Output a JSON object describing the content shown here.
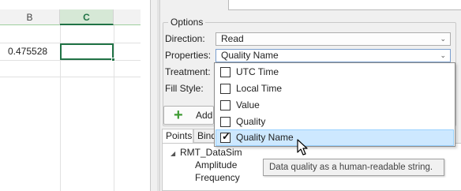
{
  "spreadsheet": {
    "columns": [
      "B",
      "C",
      ""
    ],
    "active_column": "C",
    "cell_b2": "0.475528",
    "cell_c2": ""
  },
  "options": {
    "group_title": "Options",
    "direction": {
      "label": "Direction:",
      "value": "Read"
    },
    "properties": {
      "label": "Properties:",
      "value": "Quality Name"
    },
    "treatment": {
      "label": "Treatment:"
    },
    "fill_style": {
      "label": "Fill Style:"
    }
  },
  "add_button": {
    "label": "Add"
  },
  "tabs": [
    {
      "label": "Points"
    },
    {
      "label": "Bind"
    }
  ],
  "tree": {
    "root": "RMT_DataSim",
    "children": [
      "Amplitude",
      "Frequency"
    ]
  },
  "properties_dropdown": {
    "options": [
      {
        "label": "UTC Time",
        "checked": false
      },
      {
        "label": "Local Time",
        "checked": false
      },
      {
        "label": "Value",
        "checked": false
      },
      {
        "label": "Quality",
        "checked": false
      },
      {
        "label": "Quality Name",
        "checked": true,
        "hovered": true
      }
    ]
  },
  "tooltip": {
    "text": "Data quality as a human-readable string."
  },
  "colors": {
    "excel_green": "#217346",
    "hover_blue": "#cde8ff",
    "add_icon_green": "#3f9b34"
  }
}
